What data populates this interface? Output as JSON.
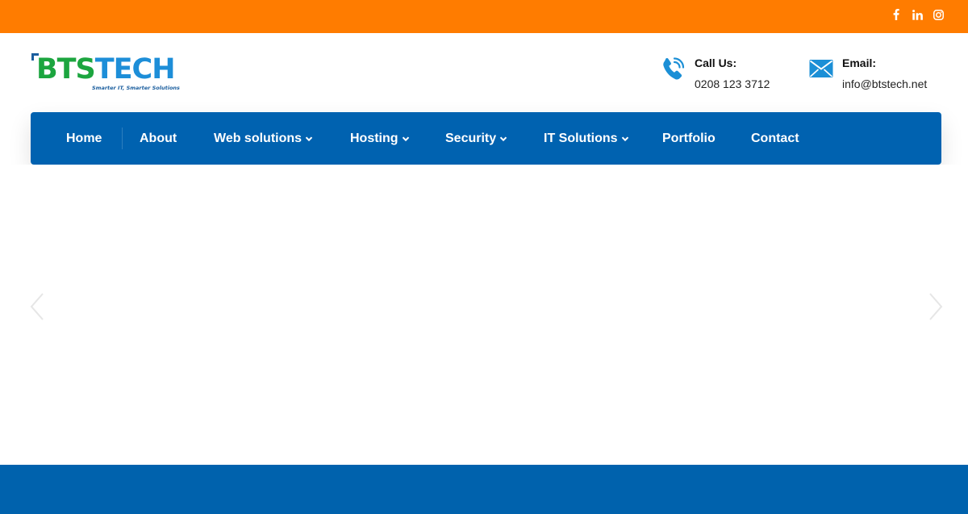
{
  "colors": {
    "topbar": "#ff7c00",
    "nav_background": "#0062b0",
    "logo_green": "#1ca53f",
    "logo_blue": "#1d8ed8",
    "icon_blue": "#1b8fd6"
  },
  "social": [
    {
      "icon": "facebook-icon"
    },
    {
      "icon": "linkedin-icon"
    },
    {
      "icon": "instagram-icon"
    }
  ],
  "logo": {
    "part_a": "BTS",
    "part_b": "TECH",
    "tagline": "Smarter IT, Smarter Solutions"
  },
  "contact": {
    "phone": {
      "icon": "phone-icon",
      "label": "Call Us:",
      "value": "0208 123 3712"
    },
    "email": {
      "icon": "envelope-icon",
      "label": "Email:",
      "value": "info@btstech.net"
    }
  },
  "nav": {
    "items": [
      {
        "label": "Home",
        "has_dropdown": false
      },
      {
        "label": "About",
        "has_dropdown": false
      },
      {
        "label": "Web solutions",
        "has_dropdown": true
      },
      {
        "label": "Hosting",
        "has_dropdown": true
      },
      {
        "label": "Security",
        "has_dropdown": true
      },
      {
        "label": "IT Solutions",
        "has_dropdown": true
      },
      {
        "label": "Portfolio",
        "has_dropdown": false
      },
      {
        "label": "Contact",
        "has_dropdown": false
      }
    ]
  },
  "slider": {
    "prev_icon": "chevron-left-icon",
    "next_icon": "chevron-right-icon"
  }
}
